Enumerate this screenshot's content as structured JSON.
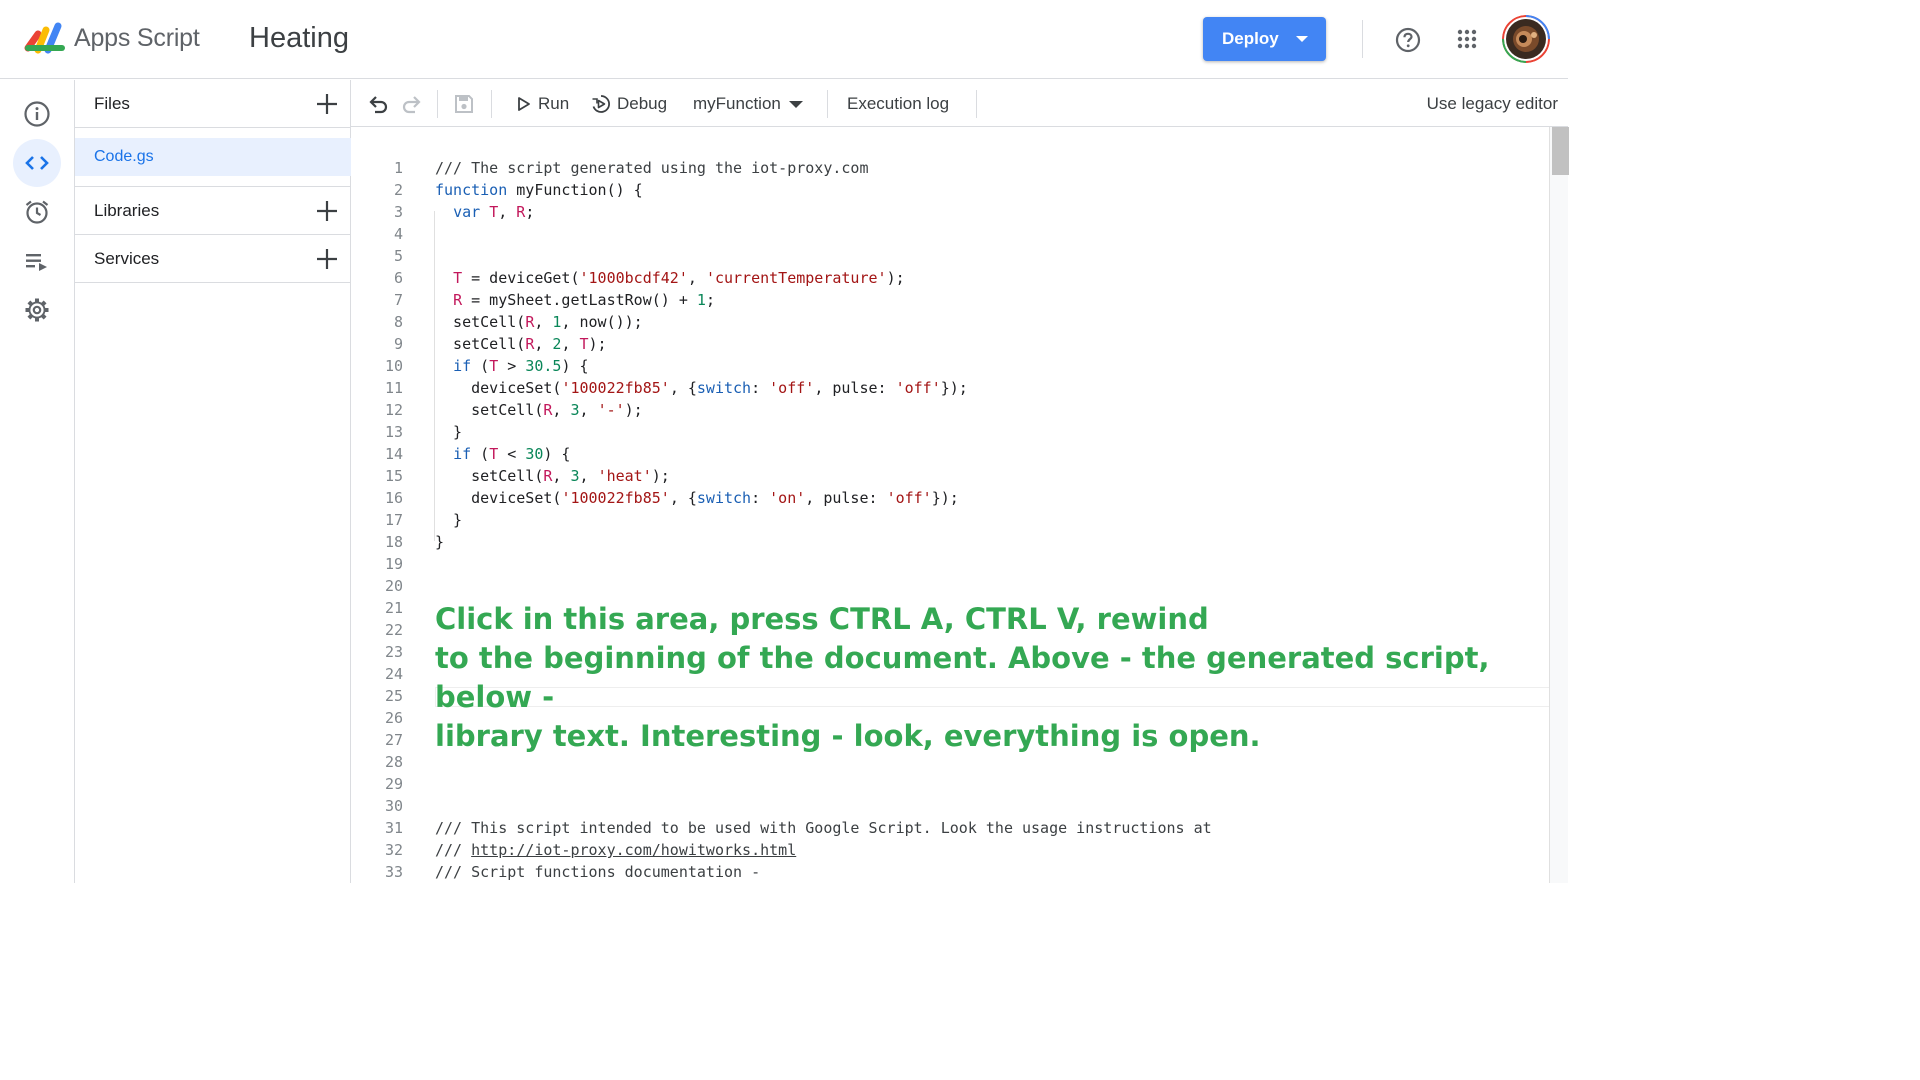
{
  "header": {
    "app_name": "Apps Script",
    "project_title": "Heating",
    "deploy_label": "Deploy",
    "help_icon": "help-circle-icon",
    "apps_icon": "google-apps-grid-icon",
    "avatar_icon": "user-avatar"
  },
  "rail": {
    "items": [
      {
        "name": "overview",
        "icon": "info-icon",
        "active": false
      },
      {
        "name": "editor",
        "icon": "code-icon",
        "active": true
      },
      {
        "name": "triggers",
        "icon": "alarm-clock-icon",
        "active": false
      },
      {
        "name": "executions",
        "icon": "list-play-icon",
        "active": false
      },
      {
        "name": "settings",
        "icon": "gear-icon",
        "active": false
      }
    ]
  },
  "files_panel": {
    "files_label": "Files",
    "file_name": "Code.gs",
    "libraries_label": "Libraries",
    "services_label": "Services"
  },
  "toolbar": {
    "run_label": "Run",
    "debug_label": "Debug",
    "function_selected": "myFunction",
    "execution_log_label": "Execution log",
    "legacy_editor_label": "Use legacy editor"
  },
  "editor": {
    "line_numbers": [
      "1",
      "2",
      "3",
      "4",
      "5",
      "6",
      "7",
      "8",
      "9",
      "10",
      "11",
      "12",
      "13",
      "14",
      "15",
      "16",
      "17",
      "18",
      "19",
      "20",
      "21",
      "22",
      "23",
      "24",
      "25",
      "26",
      "27",
      "28",
      "29",
      "30",
      "31",
      "32",
      "33"
    ],
    "code_lines": [
      [
        {
          "t": "/// The script generated using the iot-proxy.com",
          "c": "cm"
        }
      ],
      [
        {
          "t": "function",
          "c": "kw"
        },
        {
          "t": " myFunction() {",
          "c": ""
        }
      ],
      [
        {
          "t": "  ",
          "c": ""
        },
        {
          "t": "var",
          "c": "kw"
        },
        {
          "t": " ",
          "c": ""
        },
        {
          "t": "T",
          "c": "var"
        },
        {
          "t": ", ",
          "c": ""
        },
        {
          "t": "R",
          "c": "var"
        },
        {
          "t": ";",
          "c": ""
        }
      ],
      [],
      [],
      [
        {
          "t": "  ",
          "c": ""
        },
        {
          "t": "T",
          "c": "var"
        },
        {
          "t": " = deviceGet(",
          "c": ""
        },
        {
          "t": "'1000bcdf42'",
          "c": "str"
        },
        {
          "t": ", ",
          "c": ""
        },
        {
          "t": "'currentTemperature'",
          "c": "str"
        },
        {
          "t": ");",
          "c": ""
        }
      ],
      [
        {
          "t": "  ",
          "c": ""
        },
        {
          "t": "R",
          "c": "var"
        },
        {
          "t": " = mySheet.getLastRow() + ",
          "c": ""
        },
        {
          "t": "1",
          "c": "num"
        },
        {
          "t": ";",
          "c": ""
        }
      ],
      [
        {
          "t": "  setCell(",
          "c": ""
        },
        {
          "t": "R",
          "c": "var"
        },
        {
          "t": ", ",
          "c": ""
        },
        {
          "t": "1",
          "c": "num"
        },
        {
          "t": ", now());",
          "c": ""
        }
      ],
      [
        {
          "t": "  setCell(",
          "c": ""
        },
        {
          "t": "R",
          "c": "var"
        },
        {
          "t": ", ",
          "c": ""
        },
        {
          "t": "2",
          "c": "num"
        },
        {
          "t": ", ",
          "c": ""
        },
        {
          "t": "T",
          "c": "var"
        },
        {
          "t": ");",
          "c": ""
        }
      ],
      [
        {
          "t": "  ",
          "c": ""
        },
        {
          "t": "if",
          "c": "kw"
        },
        {
          "t": " (",
          "c": ""
        },
        {
          "t": "T",
          "c": "var"
        },
        {
          "t": " > ",
          "c": ""
        },
        {
          "t": "30.5",
          "c": "num"
        },
        {
          "t": ") {",
          "c": ""
        }
      ],
      [
        {
          "t": "    deviceSet(",
          "c": ""
        },
        {
          "t": "'100022fb85'",
          "c": "str"
        },
        {
          "t": ", {",
          "c": ""
        },
        {
          "t": "switch",
          "c": "kw"
        },
        {
          "t": ": ",
          "c": ""
        },
        {
          "t": "'off'",
          "c": "str"
        },
        {
          "t": ", pulse: ",
          "c": ""
        },
        {
          "t": "'off'",
          "c": "str"
        },
        {
          "t": "});",
          "c": ""
        }
      ],
      [
        {
          "t": "    setCell(",
          "c": ""
        },
        {
          "t": "R",
          "c": "var"
        },
        {
          "t": ", ",
          "c": ""
        },
        {
          "t": "3",
          "c": "num"
        },
        {
          "t": ", ",
          "c": ""
        },
        {
          "t": "'-'",
          "c": "str"
        },
        {
          "t": ");",
          "c": ""
        }
      ],
      [
        {
          "t": "  }",
          "c": ""
        }
      ],
      [
        {
          "t": "  ",
          "c": ""
        },
        {
          "t": "if",
          "c": "kw"
        },
        {
          "t": " (",
          "c": ""
        },
        {
          "t": "T",
          "c": "var"
        },
        {
          "t": " < ",
          "c": ""
        },
        {
          "t": "30",
          "c": "num"
        },
        {
          "t": ") {",
          "c": ""
        }
      ],
      [
        {
          "t": "    setCell(",
          "c": ""
        },
        {
          "t": "R",
          "c": "var"
        },
        {
          "t": ", ",
          "c": ""
        },
        {
          "t": "3",
          "c": "num"
        },
        {
          "t": ", ",
          "c": ""
        },
        {
          "t": "'heat'",
          "c": "str"
        },
        {
          "t": ");",
          "c": ""
        }
      ],
      [
        {
          "t": "    deviceSet(",
          "c": ""
        },
        {
          "t": "'100022fb85'",
          "c": "str"
        },
        {
          "t": ", {",
          "c": ""
        },
        {
          "t": "switch",
          "c": "kw"
        },
        {
          "t": ": ",
          "c": ""
        },
        {
          "t": "'on'",
          "c": "str"
        },
        {
          "t": ", pulse: ",
          "c": ""
        },
        {
          "t": "'off'",
          "c": "str"
        },
        {
          "t": "});",
          "c": ""
        }
      ],
      [
        {
          "t": "  }",
          "c": ""
        }
      ],
      [
        {
          "t": "}",
          "c": ""
        }
      ],
      [],
      [],
      [],
      [],
      [],
      [],
      [],
      [],
      [],
      [],
      [],
      [],
      [
        {
          "t": "/// This script intended to be used with Google Script. Look the usage instructions at",
          "c": "cm"
        }
      ],
      [
        {
          "t": "/// ",
          "c": "cm"
        },
        {
          "t": "http://iot-proxy.com/howitworks.html",
          "c": "link"
        }
      ],
      [
        {
          "t": "/// Script functions documentation -",
          "c": "cm"
        }
      ]
    ],
    "annotation_lines": [
      "Click in this area, press CTRL A, CTRL V, rewind",
      "to the beginning of the document. Above - the generated script, below -",
      "library text. Interesting - look, everything is open."
    ]
  },
  "colors": {
    "accent": "#4285f4",
    "active_file_bg": "#e8f0fe",
    "annotation_green": "#34a853"
  }
}
